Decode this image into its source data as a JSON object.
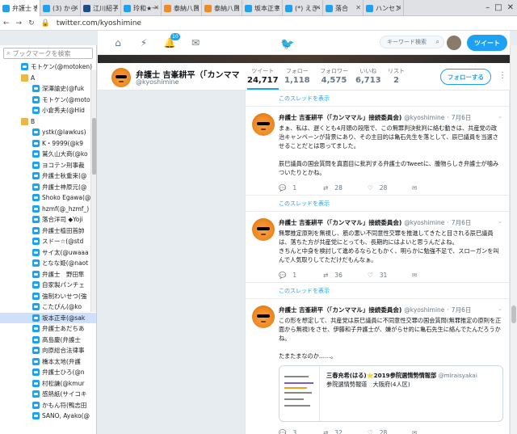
{
  "tabs": [
    {
      "label": "弁護士 吉峯",
      "color": "#1da1f2",
      "active": true
    },
    {
      "label": "(3) からの",
      "color": "#1da1f2"
    },
    {
      "label": "江川紹子",
      "color": "#1a4e8c"
    },
    {
      "label": "玲和★一",
      "color": "#1da1f2"
    },
    {
      "label": "泰納八目",
      "color": "#f08a22"
    },
    {
      "label": "泰納八目",
      "color": "#f08a22"
    },
    {
      "label": "坂本正幸",
      "color": "#1da1f2"
    },
    {
      "label": "(*) えきく",
      "color": "#1da1f2"
    },
    {
      "label": "落合",
      "color": "#1da1f2"
    },
    {
      "label": "ハンセン",
      "color": "#1da1f2"
    }
  ],
  "address": {
    "url": "twitter.com/kyoshimine"
  },
  "sidebar": {
    "search_placeholder": "ブックマークを検索",
    "items": [
      {
        "label": "モトケン(@motoken)",
        "kind": "tw",
        "indent": 26
      },
      {
        "label": "A",
        "kind": "folder",
        "indent": 26
      },
      {
        "label": "深澤諭史(@fuk",
        "kind": "tw",
        "indent": 40
      },
      {
        "label": "モトケン(@moto",
        "kind": "tw",
        "indent": 40
      },
      {
        "label": "小倉秀夫(@Hid",
        "kind": "tw",
        "indent": 40
      },
      {
        "label": "B",
        "kind": "folder",
        "indent": 26
      },
      {
        "label": "ystk(@lawkus)",
        "kind": "tw",
        "indent": 40
      },
      {
        "label": "K・9999(@k9",
        "kind": "tw",
        "indent": 40
      },
      {
        "label": "鷲久山大商(@ko",
        "kind": "tw",
        "indent": 40
      },
      {
        "label": "ヨコテン刑事裁",
        "kind": "tw",
        "indent": 40
      },
      {
        "label": "弁護士秋重束(@",
        "kind": "tw",
        "indent": 40
      },
      {
        "label": "弁護士神原元(@",
        "kind": "tw",
        "indent": 40
      },
      {
        "label": "Shoko Egawa(@",
        "kind": "tw",
        "indent": 40
      },
      {
        "label": "hzmf(@_hzmf_)",
        "kind": "tw",
        "indent": 40
      },
      {
        "label": "落合洋司 ◆Yoji",
        "kind": "tw",
        "indent": 40
      },
      {
        "label": "弁護士植田首帥",
        "kind": "tw",
        "indent": 40
      },
      {
        "label": "スドー☆(@std",
        "kind": "tw",
        "indent": 40
      },
      {
        "label": "サイ太(@uwaaa",
        "kind": "tw",
        "indent": 40
      },
      {
        "label": "となな姫(@naot",
        "kind": "tw",
        "indent": 40
      },
      {
        "label": "弁護士　野田隼",
        "kind": "tw",
        "indent": 40
      },
      {
        "label": "自家製パンチェ",
        "kind": "tw",
        "indent": 40
      },
      {
        "label": "強制わいせつ(強",
        "kind": "tw",
        "indent": 40
      },
      {
        "label": "こたぴん(@ko",
        "kind": "tw",
        "indent": 40
      },
      {
        "label": "坂本正幸(@sak",
        "kind": "tw",
        "indent": 40,
        "selected": true
      },
      {
        "label": "弁護士あだちあ",
        "kind": "tw",
        "indent": 40
      },
      {
        "label": "高島慶(弁護士",
        "kind": "tw",
        "indent": 40
      },
      {
        "label": "向原総合法律事",
        "kind": "tw",
        "indent": 40
      },
      {
        "label": "橋本太地(弁護",
        "kind": "tw",
        "indent": 40
      },
      {
        "label": "弁護士ひろ(@n",
        "kind": "tw",
        "indent": 40
      },
      {
        "label": "村松謙(@kmur",
        "kind": "tw",
        "indent": 40
      },
      {
        "label": "感熱紙(サイコキ",
        "kind": "tw",
        "indent": 40
      },
      {
        "label": "かもん符(鴨志田",
        "kind": "tw",
        "indent": 40
      },
      {
        "label": "SANO, Ayako(@",
        "kind": "tw",
        "indent": 40
      }
    ]
  },
  "header": {
    "search_placeholder": "キーワード検索",
    "tweet_button": "ツイート",
    "notif_count": "10"
  },
  "profile": {
    "name": "弁護士 吉峯耕平（「カンママル」",
    "handle": "@kyoshimine",
    "stats": [
      {
        "label": "ツイート",
        "value": "24,717",
        "on": true
      },
      {
        "label": "フォロー",
        "value": "1,118"
      },
      {
        "label": "フォロワー",
        "value": "4,575"
      },
      {
        "label": "いいね",
        "value": "6,713"
      },
      {
        "label": "リスト",
        "value": "2"
      }
    ],
    "follow_button": "フォローする"
  },
  "feed": {
    "thread_link": "このスレッドを表示",
    "tweets": [
      {
        "name": "弁護士 吉峯耕平（「カンママル」接続委員会)",
        "handle": "@kyoshimine",
        "date": "7月6日",
        "text": "まぁ、私は、遅くとも4月頭の段階で、この無罪判決批判に絡む動きは、共産党の政治キャンペーンが背景にあり、その主目的は亀石先生を落として、辰巳議員を当選させることだとは思ってました。\n\n辰巳議員の国会質問を真面目に批判する弁護士のTweetに、腫物らしき弁護士が噛みついたりとかね。",
        "reply": "1",
        "retweet": "28",
        "like": "28"
      },
      {
        "name": "弁護士 吉峯耕平（「カンママル」接続委員会)",
        "handle": "@kyoshimine",
        "date": "7月6日",
        "text": "無罪推定原則を無視し、筋の悪い不同意性交罪を推進してきたと目される辰巳議員は、落ちた方が共産党にとっても、長期的にはよいと思うんだよね。\nきちんと中身を検討して進めるならともかく、明らかに勉強不足で、スローガンを叫んで人気取りしてただけだもんなぁ。",
        "reply": "1",
        "retweet": "36",
        "like": "31"
      },
      {
        "name": "弁護士 吉峯耕平（「カンママル」接続委員会)",
        "handle": "@kyoshimine",
        "date": "7月6日",
        "text": "この形を想定して、共産党は辰巳議員に不同意性交罪の国会質問(無罪推定の原則を正面から無視)をさせ、伊藤和子弁護士が、嫌がらせ的に亀石先生に絡んでたんだろうかね。\n\nたまたまなのか……。",
        "card": {
          "title": "三春充希(はる)⭐2019参院選情勢情報部",
          "title_handle": "@miraisyakai",
          "sub": "参院選情勢報道　大阪府(4人区)"
        },
        "reply": "3",
        "retweet": "32",
        "like": "28"
      }
    ]
  }
}
